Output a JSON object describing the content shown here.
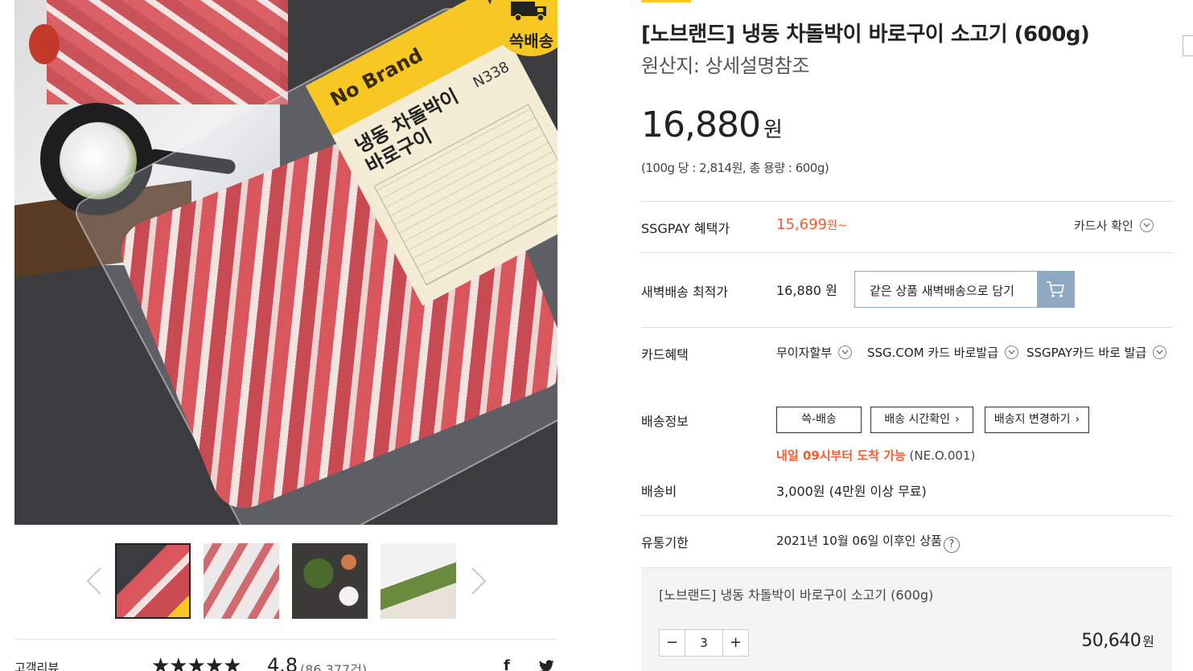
{
  "product": {
    "title": "[노브랜드] 냉동 차돌박이 바로구이 소고기 (600g)",
    "origin": "원산지: 상세설명참조",
    "price": "16,880",
    "price_unit": "원",
    "unit_price": "(100g 당 : 2,814원, 총 용량 : 600g)"
  },
  "image": {
    "badge": "쓱배송",
    "label_brand": "No Brand",
    "label_name": "냉동 차돌박이 바로구이",
    "label_code": "N338"
  },
  "ssgpay": {
    "label": "SSGPAY 혜택가",
    "price": "15,699",
    "suffix": "원~",
    "card_check": "카드사 확인"
  },
  "dawn": {
    "label": "새벽배송 최적가",
    "price": "16,880 원",
    "button": "같은 상품 새벽배송으로 담기"
  },
  "card_benefit": {
    "label": "카드혜택",
    "items": [
      "무이자할부",
      "SSG.COM 카드 바로발급",
      "SSGPAY카드 바로 발급"
    ]
  },
  "shipping": {
    "label": "배송정보",
    "buttons": [
      "쓱-배송",
      "배송 시간확인",
      "배송지 변경하기"
    ],
    "arrival_highlight": "내일 09시부터 도착 가능",
    "arrival_code": "(NE.O.001)",
    "fee_label": "배송비",
    "fee": "3,000원 (4만원 이상 무료)"
  },
  "expiry": {
    "label": "유통기한",
    "value": "2021년 10월 06일 이후인 상품",
    "help": "?"
  },
  "option": {
    "name": "[노브랜드] 냉동 차돌박이 바로구이 소고기 (600g)",
    "minus": "−",
    "plus": "+",
    "quantity": "3",
    "total": "50,640",
    "total_unit": "원"
  },
  "review": {
    "label": "고객리뷰",
    "stars": "★★★★★",
    "rating_value": 4.8,
    "rating": "4.8",
    "count": "(86,377건)"
  },
  "share": {
    "facebook": "f"
  },
  "colors": {
    "accent": "#ff5a2e",
    "brand_yellow": "#f7c823",
    "cart_blue": "#8fa9c3"
  }
}
